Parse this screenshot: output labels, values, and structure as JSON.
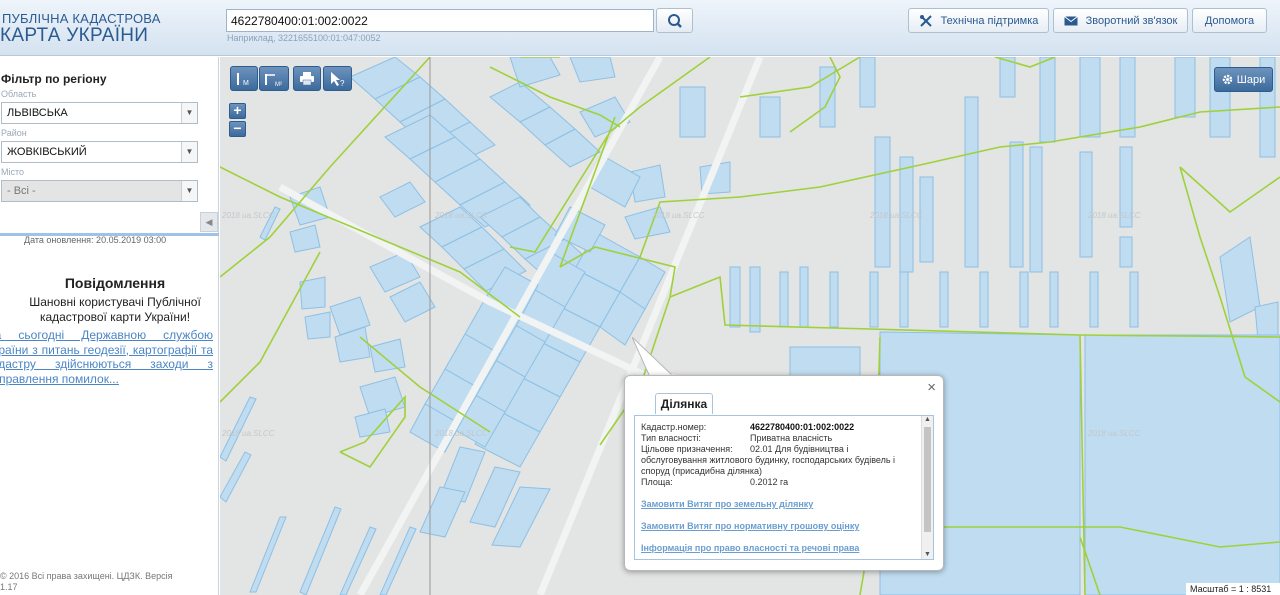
{
  "header": {
    "logo_line1": "ПУБЛІЧНА КАДАСТРОВА",
    "logo_line2": "КАРТА УКРАЇНИ",
    "search_value": "4622780400:01:002:0022",
    "search_hint": "Наприклад, 3221655100:01:047:0052",
    "support_label": "Технічна підтримка",
    "feedback_label": "Зворотний зв'язок",
    "help_label": "Допомога"
  },
  "sidebar": {
    "filter_title": "Фільтр по регіону",
    "oblast_label": "Область",
    "oblast_value": "ЛЬВІВСЬКА",
    "raion_label": "Район",
    "raion_value": "ЖОВКІВСЬКИЙ",
    "city_label": "Місто",
    "city_value": "- Всі -",
    "update_date": "Дата оновлення: 20.05.2019 03:00",
    "news_title": "Повідомлення",
    "news_text": "Шановні користувачі Публічної кадастрової карти України!",
    "news_link": "На сьогодні Державною службою України з питань геодезії, картографії та кадастру здійснюються заходи з виправлення помилок...",
    "copyright": "© 2016 Всі права захищені. ЦДЗК. Версія 1.17"
  },
  "map": {
    "layers_label": "Шари",
    "watermark": "2018 ua.SLCC",
    "scale_text": "Масштаб = 1 : 8531"
  },
  "popup": {
    "tab_label": "Ділянка",
    "cad_label": "Кадастр.номер:",
    "cad_value": "4622780400:01:002:0022",
    "own_label": "Тип власності:",
    "own_value": "Приватна власність",
    "purpose_label": "Цільове призначення:",
    "purpose_value_1": "02.01 Для будівництва і",
    "purpose_value_2": "обслуговування житлового будинку, господарських будівель і",
    "purpose_value_3": "споруд (присадибна ділянка)",
    "area_label": "Площа:",
    "area_value": "0.2012 га",
    "link1": "Замовити Витяг про земельну ділянку",
    "link2": "Замовити Витяг про нормативну грошову оцінку",
    "link3": "Інформація про право власності та речові права",
    "close_glyph": "×"
  },
  "colors": {
    "parcel_fill": "#b9d8ee",
    "parcel_stroke": "#8ec0e4",
    "boundary": "#9fd13a",
    "map_bg": "#e3e4e4"
  }
}
